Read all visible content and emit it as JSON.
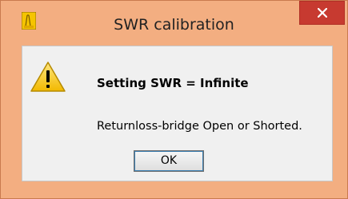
{
  "window": {
    "title": "SWR calibration",
    "app_icon": "app-icon",
    "close_icon": "close-icon",
    "close_color": "#c73a30",
    "frame_color": "#f3ae81"
  },
  "dialog": {
    "icon": "warning-icon",
    "heading": "Setting SWR = Infinite",
    "message": "Returnloss-bridge Open or Shorted.",
    "ok_label": "OK"
  }
}
